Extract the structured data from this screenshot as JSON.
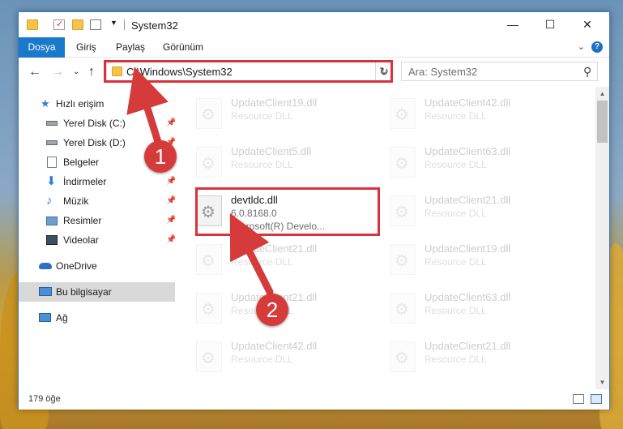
{
  "window": {
    "title": "System32",
    "controls": {
      "minimize": "—",
      "maximize": "☐",
      "close": "✕"
    }
  },
  "ribbon": {
    "tabs": [
      "Dosya",
      "Giriş",
      "Paylaş",
      "Görünüm"
    ],
    "help": "?"
  },
  "nav": {
    "address": "C:\\Windows\\System32",
    "search_placeholder": "Ara: System32"
  },
  "sidebar": {
    "items": [
      {
        "label": "Hızlı erişim",
        "icon": "star-icon",
        "pinned": false
      },
      {
        "label": "Yerel Disk (C:)",
        "icon": "drive-icon",
        "pinned": true
      },
      {
        "label": "Yerel Disk (D:)",
        "icon": "drive-icon",
        "pinned": true
      },
      {
        "label": "Belgeler",
        "icon": "documents-icon",
        "pinned": true
      },
      {
        "label": "İndirmeler",
        "icon": "download-icon",
        "pinned": true
      },
      {
        "label": "Müzik",
        "icon": "music-icon",
        "pinned": true
      },
      {
        "label": "Resimler",
        "icon": "pictures-icon",
        "pinned": true
      },
      {
        "label": "Videolar",
        "icon": "video-icon",
        "pinned": true
      },
      {
        "label": "OneDrive",
        "icon": "cloud-icon",
        "pinned": false
      },
      {
        "label": "Bu bilgisayar",
        "icon": "computer-icon",
        "pinned": false,
        "selected": true
      },
      {
        "label": "Ağ",
        "icon": "network-icon",
        "pinned": false
      }
    ]
  },
  "files": {
    "left": [
      {
        "name": "UpdateClient19.dll",
        "sub": "Resource DLL"
      },
      {
        "name": "UpdateClient5.dll",
        "sub": "Resource DLL"
      },
      {
        "name": "devtldc.dll",
        "sub1": "6.0.8168.0",
        "sub2": "Microsoft(R) Develo...",
        "highlighted": true
      },
      {
        "name": "UpdateClient21.dll",
        "sub": "Resource DLL"
      },
      {
        "name": "UpdateClient21.dll",
        "sub": "Resource DLL"
      },
      {
        "name": "UpdateClient42.dll",
        "sub": "Resource DLL"
      }
    ],
    "right": [
      {
        "name": "UpdateClient42.dll",
        "sub": "Resource DLL"
      },
      {
        "name": "UpdateClient63.dll",
        "sub": "Resource DLL"
      },
      {
        "name": "UpdateClient21.dll",
        "sub": "Resource DLL"
      },
      {
        "name": "UpdateClient19.dll",
        "sub": "Resource DLL"
      },
      {
        "name": "UpdateClient63.dll",
        "sub": "Resource DLL"
      },
      {
        "name": "UpdateClient21.dll",
        "sub": "Resource DLL"
      }
    ]
  },
  "status": {
    "count": "179 öğe"
  },
  "callouts": [
    "1",
    "2"
  ],
  "colors": {
    "accent": "#1979ca",
    "highlight": "#d8333a",
    "selected": "#d9d9d9"
  }
}
